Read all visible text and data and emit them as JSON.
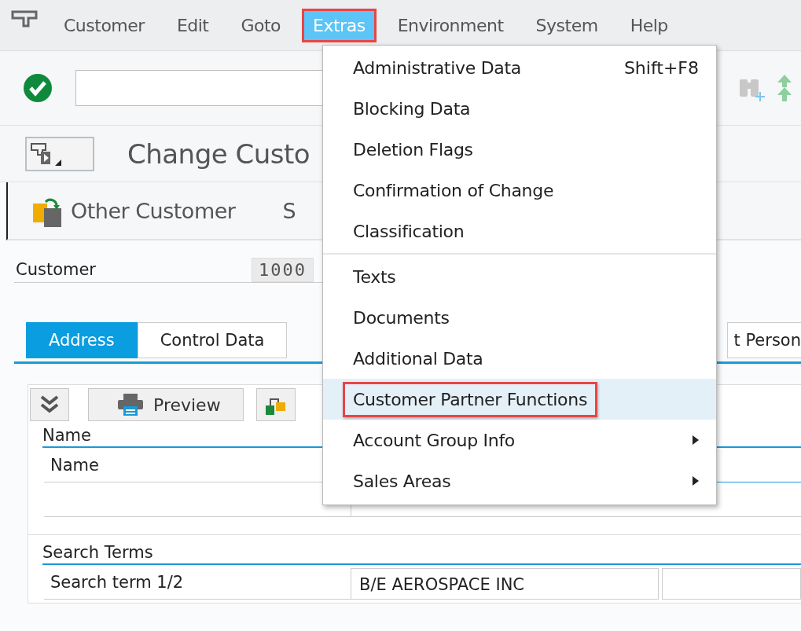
{
  "menubar": {
    "items": [
      {
        "label": "Customer",
        "selected": false,
        "annotated": false
      },
      {
        "label": "Edit",
        "selected": false,
        "annotated": false
      },
      {
        "label": "Goto",
        "selected": false,
        "annotated": false
      },
      {
        "label": "Extras",
        "selected": true,
        "annotated": true
      },
      {
        "label": "Environment",
        "selected": false,
        "annotated": false
      },
      {
        "label": "System",
        "selected": false,
        "annotated": false
      },
      {
        "label": "Help",
        "selected": false,
        "annotated": false
      }
    ]
  },
  "title": "Change Custo",
  "app_toolbar": {
    "buttons": [
      {
        "kind": "icon_text",
        "label": "Other Customer"
      },
      {
        "kind": "text",
        "label": "S"
      }
    ]
  },
  "customer": {
    "label": "Customer",
    "value": "1000"
  },
  "tabs": [
    {
      "label": "Address",
      "selected": true
    },
    {
      "label": "Control Data",
      "selected": false
    },
    {
      "label": "t Person",
      "selected": false
    }
  ],
  "panel": {
    "buttons": [
      {
        "kind": "collapse"
      },
      {
        "kind": "preview",
        "label": "Preview"
      },
      {
        "kind": "structure"
      }
    ],
    "sections": [
      {
        "title": "Name",
        "rows": [
          {
            "label": "Name"
          },
          {}
        ]
      },
      {
        "title": "Search Terms",
        "rows": [
          {
            "label": "Search term 1/2",
            "value": "B/E AEROSPACE INC"
          }
        ]
      }
    ]
  },
  "menu": {
    "groups": [
      [
        {
          "label": "Administrative Data",
          "shortcut": "Shift+F8",
          "submenu": false,
          "selected": false,
          "annotated": false
        },
        {
          "label": "Blocking Data",
          "submenu": false,
          "selected": false,
          "annotated": false
        },
        {
          "label": "Deletion Flags",
          "submenu": false,
          "selected": false,
          "annotated": false
        },
        {
          "label": "Confirmation of Change",
          "submenu": false,
          "selected": false,
          "annotated": false
        },
        {
          "label": "Classification",
          "submenu": false,
          "selected": false,
          "annotated": false
        }
      ],
      [
        {
          "label": "Texts",
          "submenu": false,
          "selected": false,
          "annotated": false
        },
        {
          "label": "Documents",
          "submenu": false,
          "selected": false,
          "annotated": false
        },
        {
          "label": "Additional Data",
          "submenu": false,
          "selected": false,
          "annotated": false
        },
        {
          "label": "Customer Partner Functions",
          "submenu": false,
          "selected": true,
          "annotated": true
        },
        {
          "label": "Account Group Info",
          "submenu": true,
          "selected": false,
          "annotated": false
        },
        {
          "label": "Sales Areas",
          "submenu": true,
          "selected": false,
          "annotated": false
        }
      ]
    ]
  }
}
